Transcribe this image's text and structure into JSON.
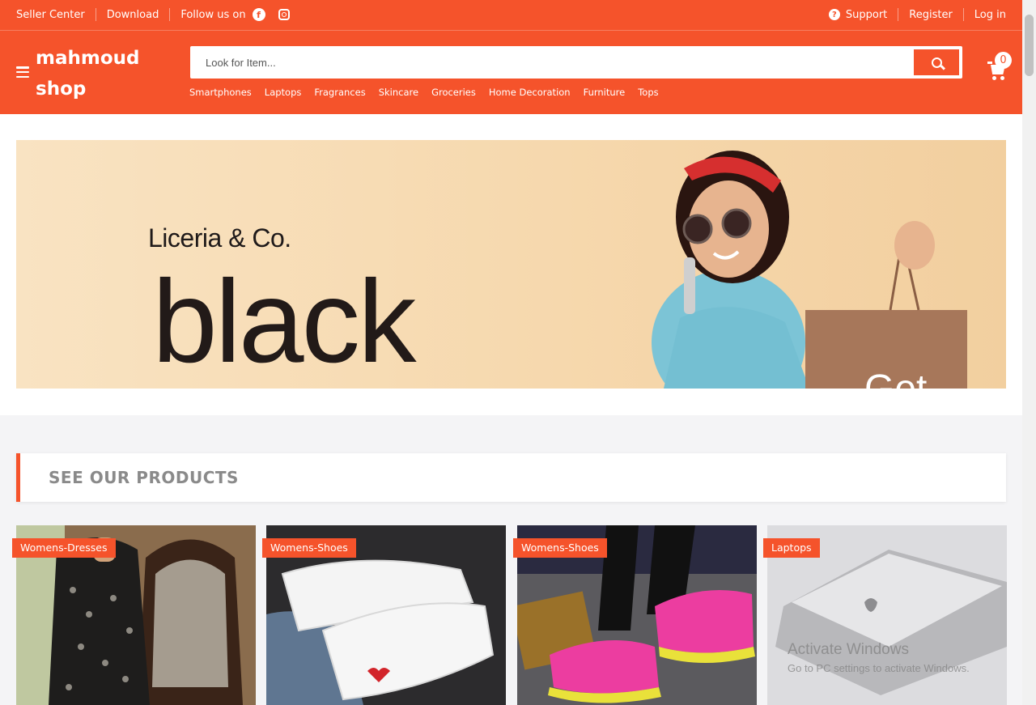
{
  "topbar": {
    "seller_center": "Seller Center",
    "download": "Download",
    "follow": "Follow us on",
    "support": "Support",
    "register": "Register",
    "login": "Log in"
  },
  "header": {
    "logo_line1": "mahmoud",
    "logo_line2": "shop",
    "search_placeholder": "Look for Item...",
    "cart_count": "0",
    "categories": [
      "Smartphones",
      "Laptops",
      "Fragrances",
      "Skincare",
      "Groceries",
      "Home Decoration",
      "Furniture",
      "Tops"
    ]
  },
  "banner": {
    "brand": "Liceria & Co.",
    "headline": "black",
    "partial_text": "Get"
  },
  "products_section": {
    "title": "SEE OUR PRODUCTS"
  },
  "products": [
    {
      "category": "Womens-Dresses"
    },
    {
      "category": "Womens-Shoes"
    },
    {
      "category": "Womens-Shoes"
    },
    {
      "category": "Laptops"
    }
  ],
  "watermark": {
    "line1": "Activate Windows",
    "line2": "Go to PC settings to activate Windows."
  },
  "colors": {
    "primary": "#f5532b",
    "banner_bg": "#f7dbb3",
    "section_title_text": "#8a8a8a"
  },
  "icons": [
    "menu-icon",
    "facebook-icon",
    "instagram-icon",
    "support-icon",
    "search-icon",
    "cart-icon"
  ]
}
